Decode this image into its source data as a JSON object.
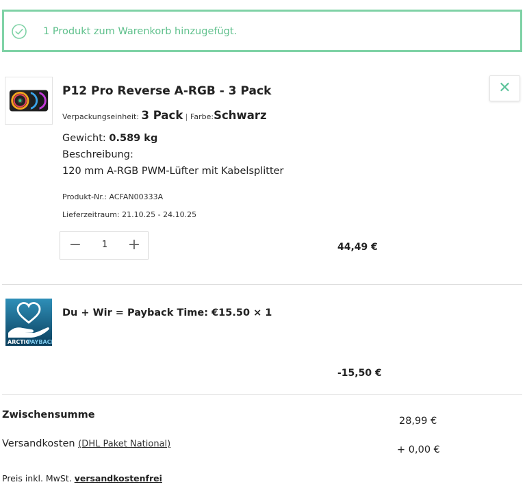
{
  "alert": {
    "message": "1 Produkt zum Warenkorb hinzugefügt.",
    "icon": "check-circle-icon",
    "color": "#7fd2a6"
  },
  "product": {
    "title": "P12 Pro Reverse A-RGB - 3 Pack",
    "packaging_label": "Verpackungseinheit:",
    "packaging_value": "3 Pack",
    "separator": "|",
    "color_label": "Farbe:",
    "color_value": "Schwarz",
    "weight_label": "Gewicht:",
    "weight_value": "0.589 kg",
    "description_label": "Beschreibung:",
    "description": "120 mm A-RGB PWM-Lüfter mit Kabelsplitter",
    "product_no": "Produkt-Nr.: ACFAN00333A",
    "delivery": "Lieferzeitraum: 21.10.25 - 24.10.25",
    "quantity": "1",
    "minus_symbol": "−",
    "plus_symbol": "+",
    "price": "44,49 €",
    "remove_icon": "close-icon",
    "remove_symbol": "✕"
  },
  "payback": {
    "image_text_1": "ARCTIC",
    "image_text_2": "PAYBACK",
    "title": "Du + Wir = Payback Time: €15.50 × 1",
    "price": "-15,50 €"
  },
  "summary": {
    "subtotal_label": "Zwischensumme",
    "subtotal_value": "28,99 €",
    "shipping_label": "Versandkosten",
    "shipping_method": "(DHL Paket National)",
    "shipping_value": "+ 0,00 €"
  },
  "footer": {
    "tax_text": "Preis inkl. MwSt.",
    "free_shipping_link": "versandkostenfrei"
  }
}
